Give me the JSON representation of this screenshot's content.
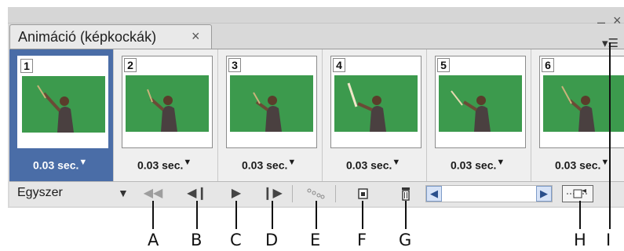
{
  "panel": {
    "tab_label": "Animáció (képkockák)",
    "tab_close": "×",
    "minimize": "–",
    "close": "×"
  },
  "frames": [
    {
      "number": "1",
      "delay": "0.03 sec.",
      "selected": true
    },
    {
      "number": "2",
      "delay": "0.03 sec.",
      "selected": false
    },
    {
      "number": "3",
      "delay": "0.03 sec.",
      "selected": false
    },
    {
      "number": "4",
      "delay": "0.03 sec.",
      "selected": false
    },
    {
      "number": "5",
      "delay": "0.03 sec.",
      "selected": false
    },
    {
      "number": "6",
      "delay": "0.03 sec.",
      "selected": false
    }
  ],
  "toolbar": {
    "loop_value": "Egyszer",
    "buttons": [
      {
        "name": "first-frame-button",
        "icon": "rewind-icon"
      },
      {
        "name": "previous-frame-button",
        "icon": "step-back-icon"
      },
      {
        "name": "play-button",
        "icon": "play-icon"
      },
      {
        "name": "next-frame-button",
        "icon": "step-forward-icon"
      },
      {
        "name": "tween-button",
        "icon": "tween-icon"
      },
      {
        "name": "duplicate-frame-button",
        "icon": "new-frame-icon"
      },
      {
        "name": "delete-frame-button",
        "icon": "trash-icon"
      },
      {
        "name": "convert-to-timeline-button",
        "icon": "timeline-icon"
      }
    ]
  },
  "callouts": [
    "A",
    "B",
    "C",
    "D",
    "E",
    "F",
    "G",
    "H",
    "I"
  ],
  "colors": {
    "selected_frame": "#4a6da7",
    "greenscreen": "#3c9a4d",
    "scroll_accent": "#2a4f8c"
  }
}
